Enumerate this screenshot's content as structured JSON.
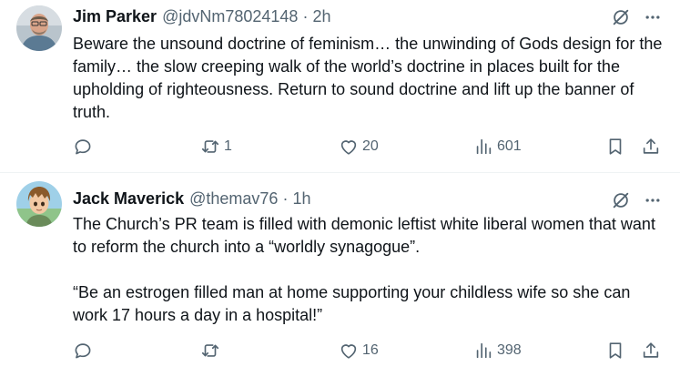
{
  "tweets": [
    {
      "author_name": "Jim Parker",
      "handle": "@jdvNm78024148",
      "separator": "·",
      "time": "2h",
      "text": [
        "Beware the unsound doctrine of feminism… the unwinding of Gods design for the family… the slow creeping walk of the world’s doctrine in places built for the upholding of righteousness. Return to sound doctrine and lift up the banner of truth."
      ],
      "replies": "",
      "reposts": "1",
      "likes": "20",
      "views": "601"
    },
    {
      "author_name": "Jack Maverick",
      "handle": "@themav76",
      "separator": "·",
      "time": "1h",
      "text": [
        "The Church’s PR team is filled with demonic leftist white liberal women that want to reform the church into a “worldly synagogue”.",
        "“Be an estrogen filled man at home supporting your childless wife so she can work 17 hours a day in a hospital!”"
      ],
      "replies": "",
      "reposts": "",
      "likes": "16",
      "views": "398"
    }
  ],
  "icons": {
    "grok": "grok-icon",
    "more": "more-icon",
    "reply": "reply-icon",
    "repost": "repost-icon",
    "like": "like-icon",
    "views": "views-icon",
    "bookmark": "bookmark-icon",
    "share": "share-icon"
  },
  "colors": {
    "text": "#0f1419",
    "secondary": "#536471",
    "divider": "#eff3f4"
  }
}
